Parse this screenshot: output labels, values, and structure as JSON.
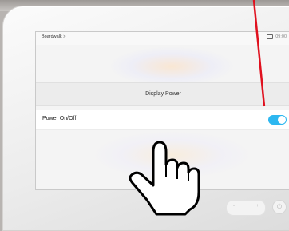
{
  "screen": {
    "breadcrumb": "Boardwalk >",
    "time": "09:00",
    "section_title": "Display Power",
    "row_label": "Power On/Off",
    "toggle_on": true
  },
  "controls": {
    "volume_down": "-",
    "volume_up": "+",
    "power_glyph": "⏻"
  },
  "colors": {
    "toggle": "#2db7f0",
    "arrow": "#e0101e"
  },
  "icons": {
    "status": "display-icon",
    "pointer": "pointing-hand-icon"
  }
}
